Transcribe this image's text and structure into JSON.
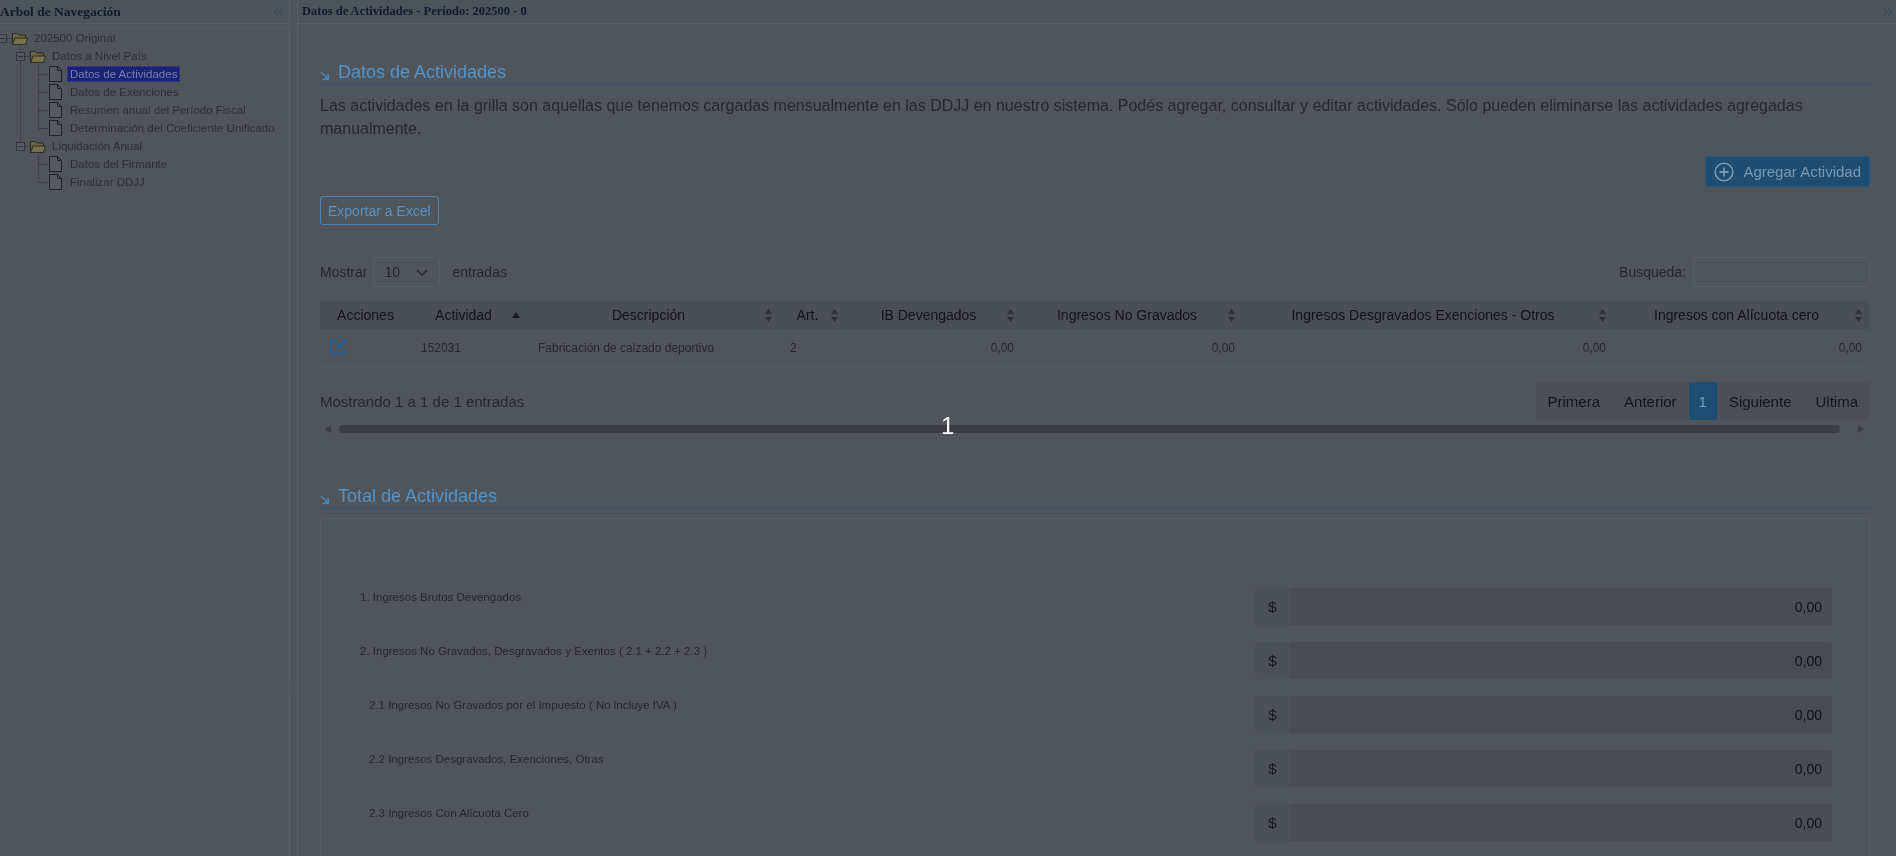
{
  "sidebar": {
    "title": "Arbol de Navegación",
    "tree": [
      {
        "label": "202500 Original",
        "expanded": true,
        "selected": false,
        "children": [
          {
            "label": "Datos a Nivel País",
            "expanded": true,
            "selected": false,
            "children": [
              {
                "label": "Datos de Actividades",
                "selected": true
              },
              {
                "label": "Datos de Exenciones",
                "selected": false
              },
              {
                "label": "Resumen anual del Período Fiscal",
                "selected": false
              },
              {
                "label": "Determinación del Coeficiente Unificado",
                "selected": false
              }
            ]
          },
          {
            "label": "Liquidación Anual",
            "expanded": true,
            "selected": false,
            "children": [
              {
                "label": "Datos del Firmante",
                "selected": false
              },
              {
                "label": "Finalizar DDJJ",
                "selected": false
              }
            ]
          }
        ]
      }
    ]
  },
  "main": {
    "title": "Datos de Actividades - Período: 202500 - 0"
  },
  "activities": {
    "heading": "Datos de Actividades",
    "description": "Las actividades en la grilla son aquellas que tenemos cargadas mensualmente en las DDJJ en nuestro sistema. Podés agregar, consultar y editar actividades. Sólo pueden eliminarse las actividades agregadas manualmente.",
    "add_button": "Agregar Actividad",
    "export_button": "Exportar a Excel",
    "length_menu": {
      "before": "Mostrar",
      "value": "10",
      "after": "entradas"
    },
    "search": {
      "label": "Busqueda:"
    },
    "table": {
      "columns": [
        {
          "label": "Acciones",
          "kind": "actions"
        },
        {
          "label": "Actividad",
          "kind": "text",
          "sorted": true
        },
        {
          "label": "Descripción",
          "kind": "text",
          "sorted": false
        },
        {
          "label": "Art.",
          "kind": "text",
          "sorted": false
        },
        {
          "label": "IB Devengados",
          "kind": "number",
          "sorted": false
        },
        {
          "label": "Ingresos No Gravados",
          "kind": "number",
          "sorted": false
        },
        {
          "label": "Ingresos Desgravados Exenciones - Otros",
          "kind": "number",
          "sorted": false
        },
        {
          "label": "Ingresos con Alícuota cero",
          "kind": "number",
          "sorted": false
        }
      ],
      "rows": [
        {
          "cells": [
            "",
            "152031",
            "Fabricación de calzado deportivo",
            "2",
            "0,00",
            "0,00",
            "0,00",
            "0,00"
          ]
        }
      ]
    },
    "info": "Mostrando 1 a 1 de 1 entradas",
    "pagination": [
      {
        "label": "Primera",
        "selected": false
      },
      {
        "label": "Anterior",
        "selected": false
      },
      {
        "label": "1",
        "selected": true
      },
      {
        "label": "Siguiente",
        "selected": false
      },
      {
        "label": "Ultima",
        "selected": false
      }
    ],
    "step_marker": "1"
  },
  "totals": {
    "heading": "Total de Actividades",
    "rows": [
      {
        "label": "1. Ingresos Brutos Devengados",
        "currency": "$",
        "value": "0,00"
      },
      {
        "label": "2. Ingresos No Gravados, Desgravados y Exentos ( 2.1 + 2.2 + 2.3 )",
        "currency": "$",
        "value": "0,00",
        "children": [
          {
            "label": "2.1 Ingresos No Gravados por el Impuesto ( No incluye IVA )",
            "currency": "$",
            "value": "0,00"
          },
          {
            "label": "2.2 Ingresos Desgravados, Exenciones, Otras",
            "currency": "$",
            "value": "0,00"
          },
          {
            "label": "2.3 Ingresos Con Alícuota Cero",
            "currency": "$",
            "value": "0,00"
          }
        ]
      }
    ]
  }
}
